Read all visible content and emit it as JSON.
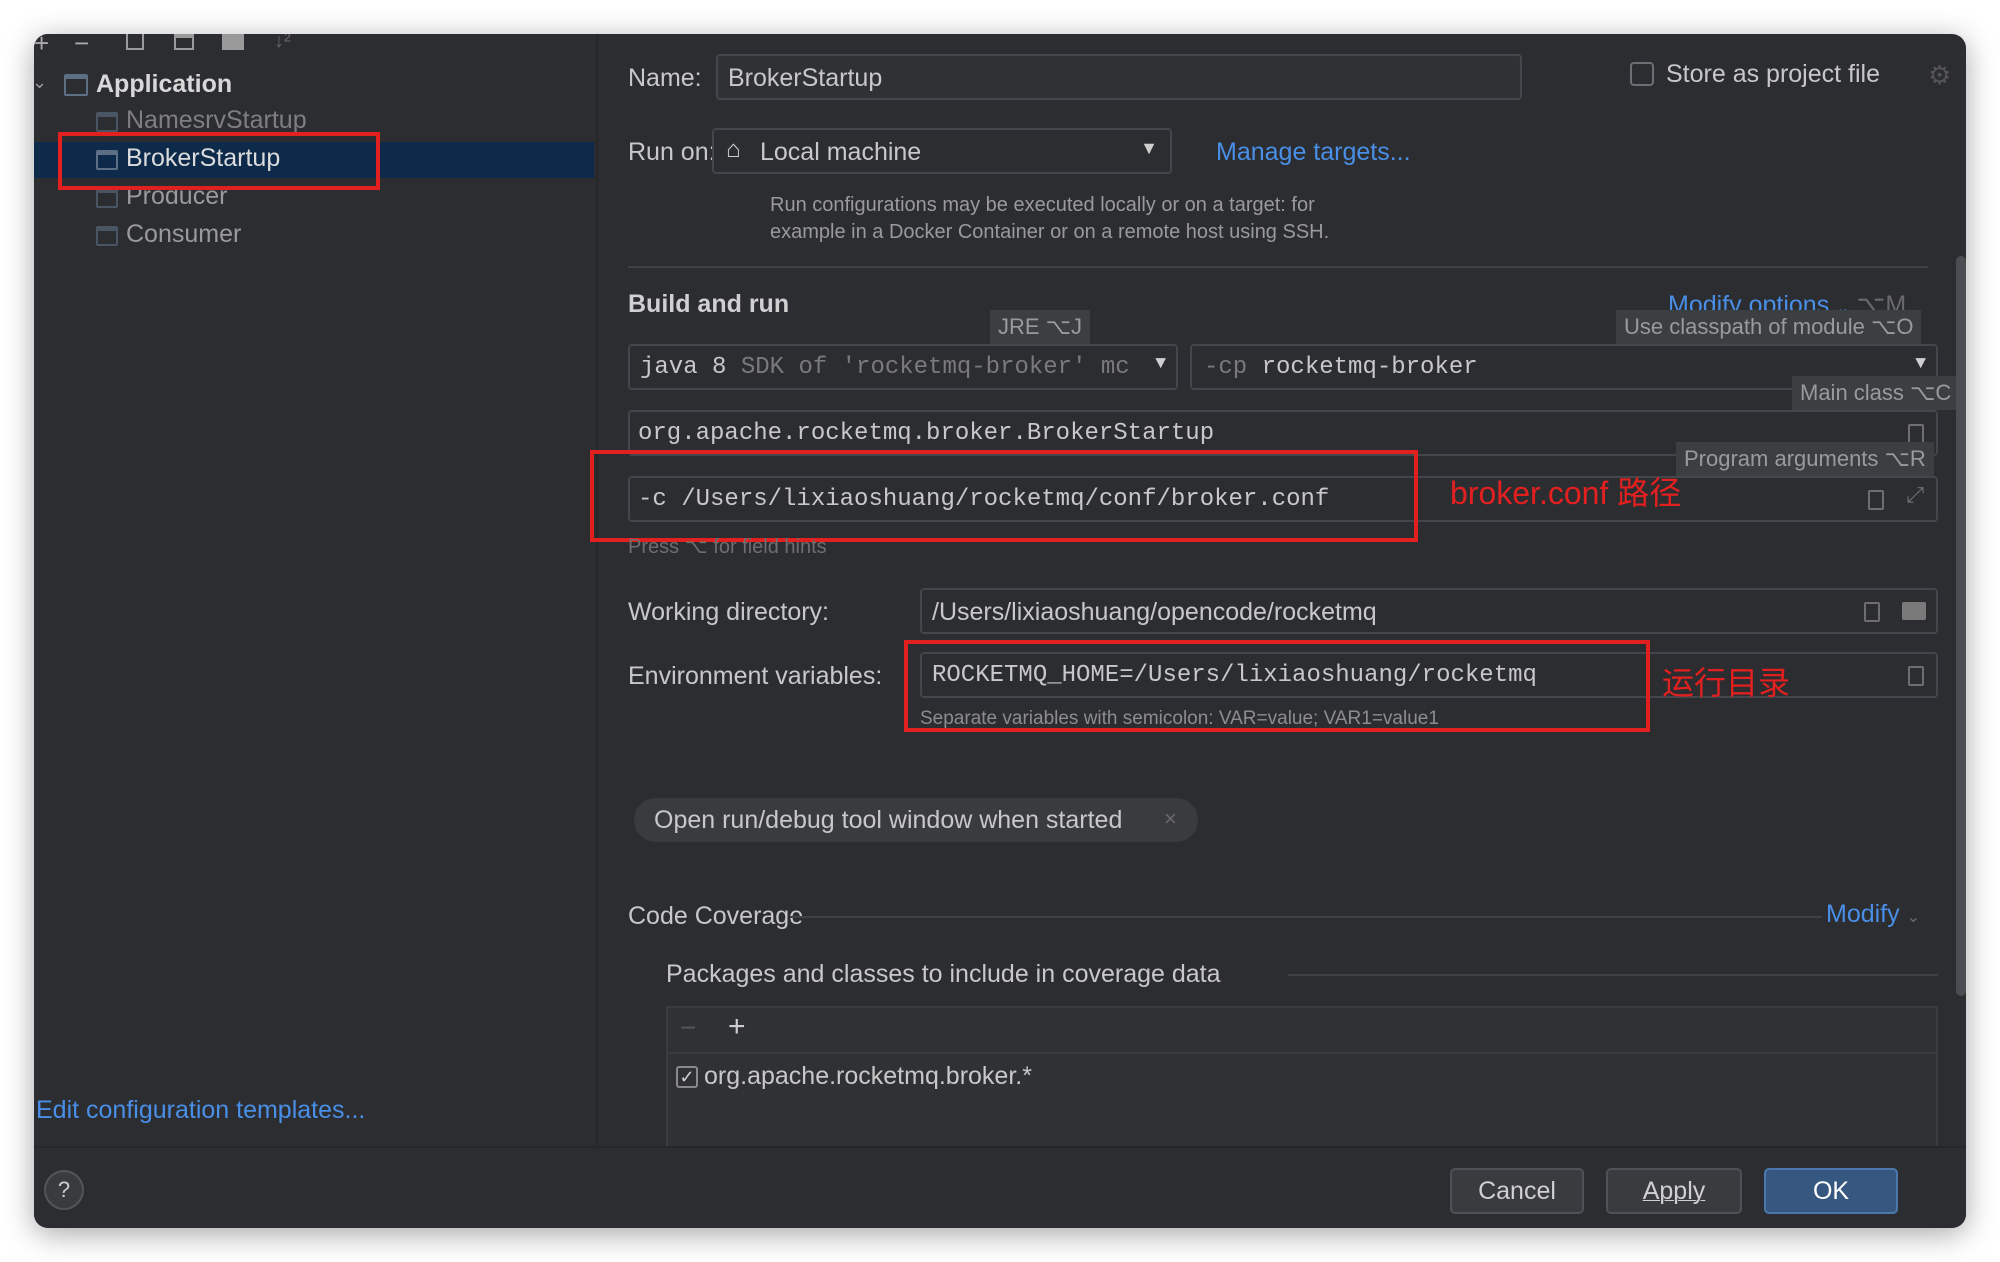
{
  "sidebar": {
    "toolbar": [
      "+",
      "−"
    ],
    "tree_root": "Application",
    "items": [
      {
        "label": "NamesrvStartup"
      },
      {
        "label": "BrokerStartup"
      },
      {
        "label": "Producer"
      },
      {
        "label": "Consumer"
      }
    ],
    "edit_templates_link": "Edit configuration templates..."
  },
  "form": {
    "name_label": "Name:",
    "name_value": "BrokerStartup",
    "store_label": "Store as project file",
    "run_on_label": "Run on:",
    "run_on_value": "Local machine",
    "manage_targets": "Manage targets...",
    "run_on_help_line1": "Run configurations may be executed locally or on a target: for",
    "run_on_help_line2": "example in a Docker Container or on a remote host using SSH.",
    "build_run_title": "Build and run",
    "modify_options": "Modify options",
    "modify_options_shortcut": "⌥M",
    "jre_hint": "JRE ⌥J",
    "classpath_hint": "Use classpath of module ⌥O",
    "main_class_hint": "Main class ⌥C",
    "program_args_hint": "Program arguments ⌥R",
    "jdk_value": "java 8",
    "jdk_suffix": "SDK of 'rocketmq-broker' mc",
    "cp_prefix": "-cp",
    "cp_value": "rocketmq-broker",
    "main_class": "org.apache.rocketmq.broker.BrokerStartup",
    "program_args": "-c /Users/lixiaoshuang/rocketmq/conf/broker.conf",
    "field_hints": "Press ⌥ for field hints",
    "workdir_label": "Working directory:",
    "workdir_value": "/Users/lixiaoshuang/opencode/rocketmq",
    "env_label": "Environment variables:",
    "env_value": "ROCKETMQ_HOME=/Users/lixiaoshuang/rocketmq",
    "env_help": "Separate variables with semicolon: VAR=value; VAR1=value1",
    "open_tool_window": "Open run/debug tool window when started",
    "code_coverage": "Code Coverage",
    "modify": "Modify",
    "packages_title": "Packages and classes to include in coverage data",
    "package_item": "org.apache.rocketmq.broker.*"
  },
  "annotations": {
    "broker_conf": "broker.conf 路径",
    "run_dir": "运行目录"
  },
  "buttons": {
    "help": "?",
    "cancel": "Cancel",
    "apply": "Apply",
    "ok": "OK"
  }
}
